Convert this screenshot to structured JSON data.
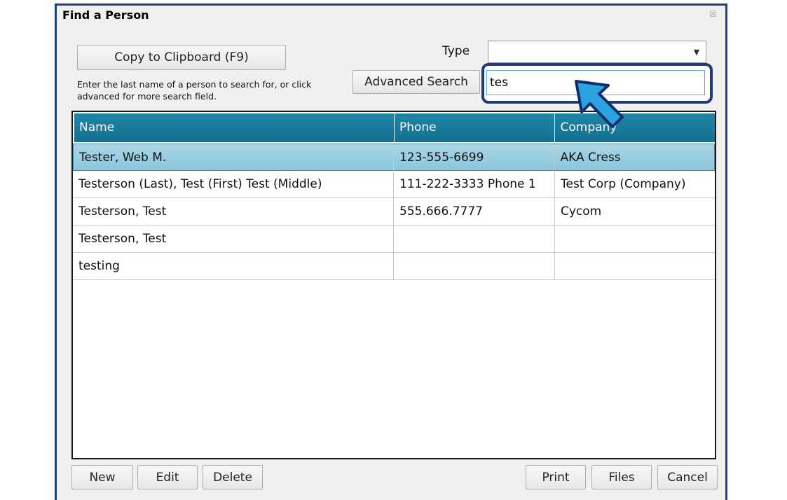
{
  "window": {
    "title": "Find a Person"
  },
  "toolbar": {
    "copy_label": "Copy to Clipboard (F9)",
    "advanced_label": "Advanced Search",
    "hint": "Enter the last name of a person to search for, or click advanced for more search field.",
    "type_label": "Type",
    "type_value": "",
    "search_value": "tes"
  },
  "table": {
    "columns": [
      "Name",
      "Phone",
      "Company"
    ],
    "rows": [
      {
        "name": "Tester, Web M.",
        "phone": "123-555-6699",
        "company": "AKA Cress",
        "selected": true
      },
      {
        "name": "Testerson (Last), Test (First) Test (Middle)",
        "phone": "111-222-3333 Phone 1",
        "company": "Test Corp (Company)"
      },
      {
        "name": "Testerson, Test",
        "phone": "555.666.7777",
        "company": "Cycom"
      },
      {
        "name": "Testerson, Test",
        "phone": "",
        "company": ""
      },
      {
        "name": "testing",
        "phone": "",
        "company": ""
      }
    ]
  },
  "footer": {
    "new_label": "New",
    "edit_label": "Edit",
    "delete_label": "Delete",
    "print_label": "Print",
    "files_label": "Files",
    "cancel_label": "Cancel"
  },
  "icons": {
    "close": "close-icon",
    "dropdown": "chevron-down-icon",
    "pointer": "arrow-pointer-icon"
  }
}
